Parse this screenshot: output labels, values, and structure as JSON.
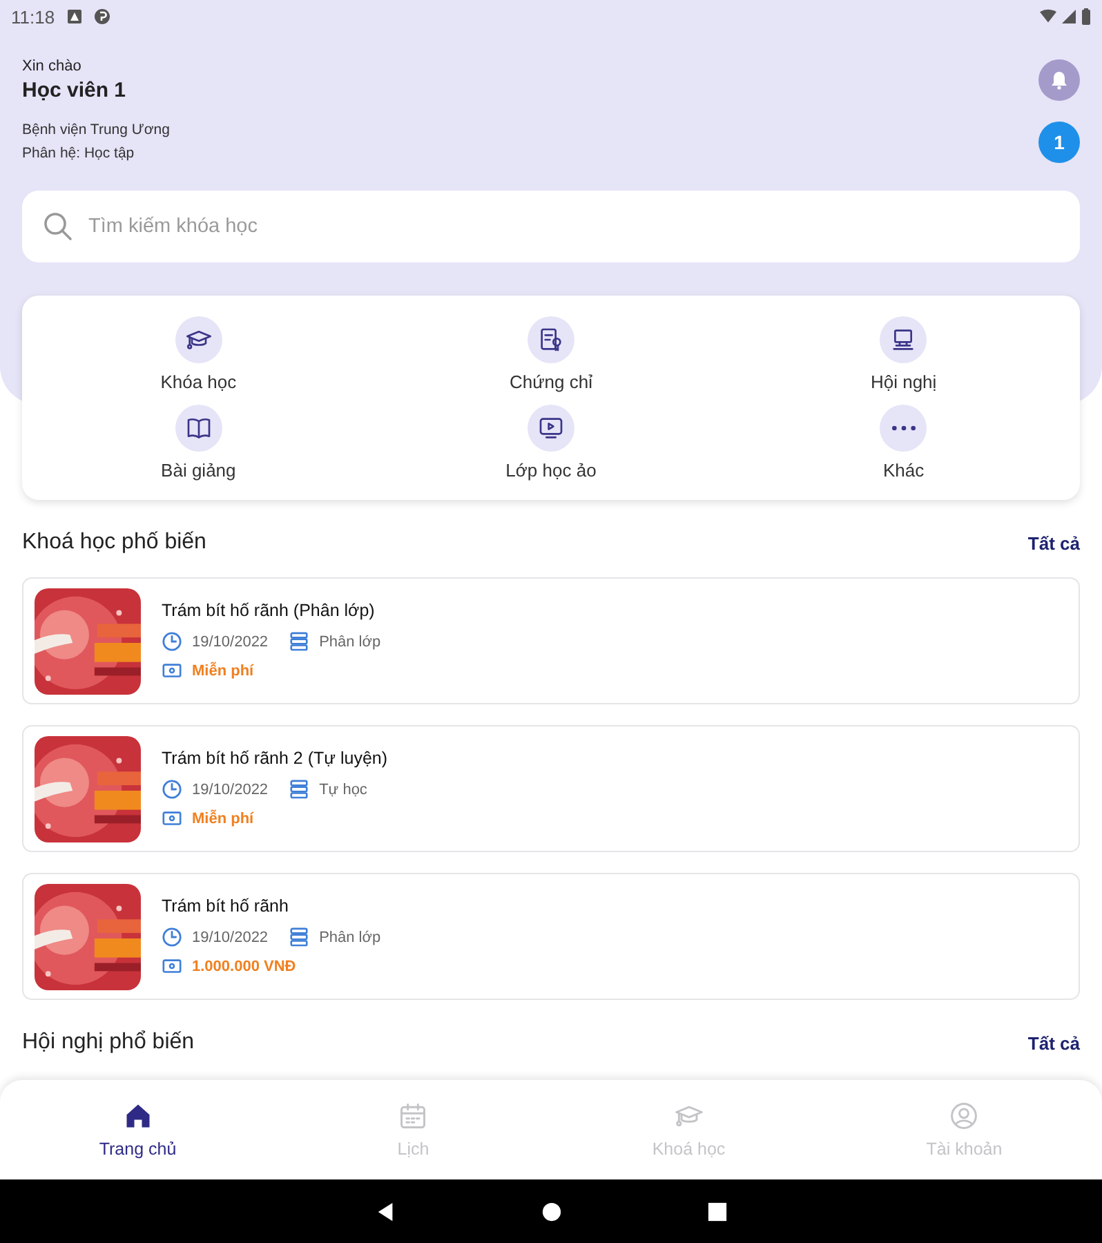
{
  "status_bar": {
    "time": "11:18"
  },
  "header": {
    "greeting": "Xin chào",
    "user_name": "Học viên 1",
    "organization": "Bệnh viện Trung Ương",
    "subsystem": "Phân hệ: Học tập",
    "badge_count": "1"
  },
  "search": {
    "placeholder": "Tìm kiếm khóa học"
  },
  "menu": [
    {
      "kind": "course",
      "label": "Khóa học"
    },
    {
      "kind": "certificate",
      "label": "Chứng chỉ"
    },
    {
      "kind": "conference",
      "label": "Hội nghị"
    },
    {
      "kind": "lecture",
      "label": "Bài giảng"
    },
    {
      "kind": "virtual_class",
      "label": "Lớp học ảo"
    },
    {
      "kind": "more",
      "label": "Khác"
    }
  ],
  "popular_courses": {
    "title": "Khoá học phố biến",
    "see_all": "Tất cả",
    "items": [
      {
        "title": "Trám bít hố rãnh (Phân lớp)",
        "date": "19/10/2022",
        "type": "Phân lớp",
        "price": "Miễn phí"
      },
      {
        "title": "Trám bít hố rãnh 2 (Tự luyện)",
        "date": "19/10/2022",
        "type": "Tự học",
        "price": "Miễn phí"
      },
      {
        "title": "Trám bít hố rãnh",
        "date": "19/10/2022",
        "type": "Phân lớp",
        "price": "1.000.000 VNĐ"
      }
    ]
  },
  "popular_conferences": {
    "title": "Hội nghị phổ biến",
    "see_all": "Tất cả"
  },
  "bottom_nav": [
    {
      "kind": "home",
      "label": "Trang chủ",
      "selected": true
    },
    {
      "kind": "calendar",
      "label": "Lịch",
      "selected": false
    },
    {
      "kind": "course",
      "label": "Khoá học",
      "selected": false
    },
    {
      "kind": "account",
      "label": "Tài khoản",
      "selected": false
    }
  ]
}
